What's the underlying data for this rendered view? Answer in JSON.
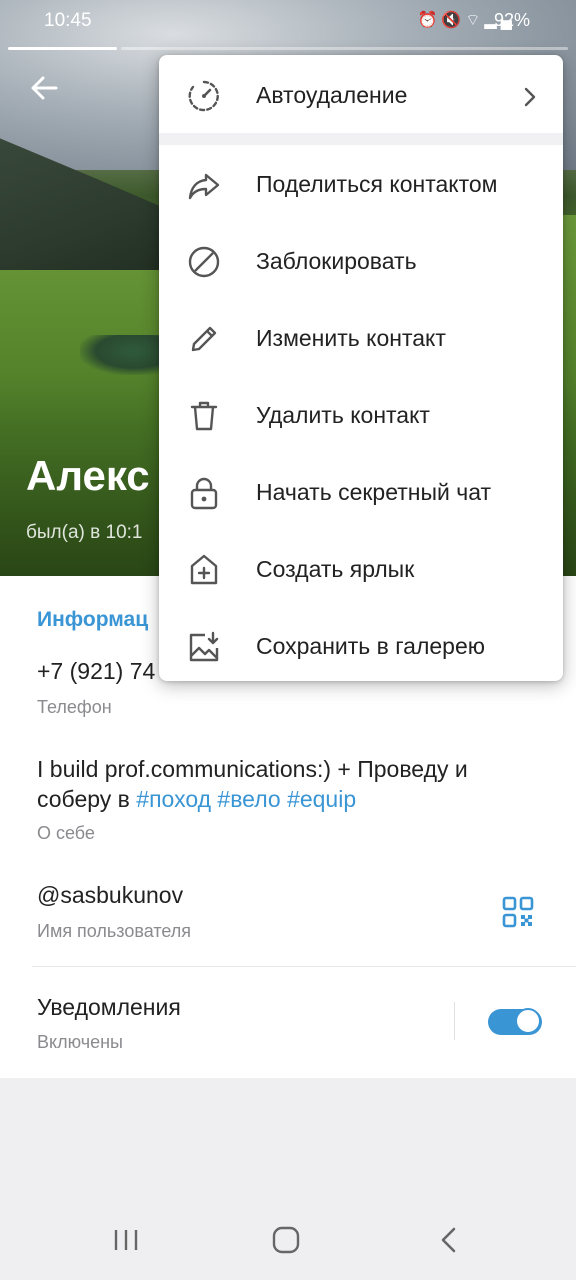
{
  "status_bar": {
    "time": "10:45",
    "icons": [
      "alarm-icon",
      "mute-icon",
      "wifi-icon",
      "signal-icon"
    ],
    "battery": "92%"
  },
  "profile": {
    "name": "Алекс",
    "last_seen": "был(а) в 10:1"
  },
  "menu": {
    "items": [
      {
        "label": "Автоудаление",
        "icon": "timer-icon"
      },
      {
        "label": "Поделиться контактом",
        "icon": "share-icon"
      },
      {
        "label": "Заблокировать",
        "icon": "block-icon"
      },
      {
        "label": "Изменить контакт",
        "icon": "pencil-icon"
      },
      {
        "label": "Удалить контакт",
        "icon": "trash-icon"
      },
      {
        "label": "Начать секретный чат",
        "icon": "lock-icon"
      },
      {
        "label": "Создать ярлык",
        "icon": "add-shortcut-icon"
      },
      {
        "label": "Сохранить в галерею",
        "icon": "save-gallery-icon"
      }
    ]
  },
  "info": {
    "section_title": "Информац",
    "phone": "+7 (921) 74",
    "phone_label": "Телефон",
    "bio_text": "I build prof.communications:) + Проведу и соберу в ",
    "bio_tags": [
      "#поход",
      "#вело",
      "#equip"
    ],
    "bio_label": "О себе",
    "username": "@sasbukunov",
    "username_label": "Имя пользователя",
    "notifications_title": "Уведомления",
    "notifications_status": "Включены"
  },
  "colors": {
    "accent": "#3a95d5",
    "text": "#222222",
    "secondary_text": "#8a8a8f",
    "background": "#efeff1"
  }
}
